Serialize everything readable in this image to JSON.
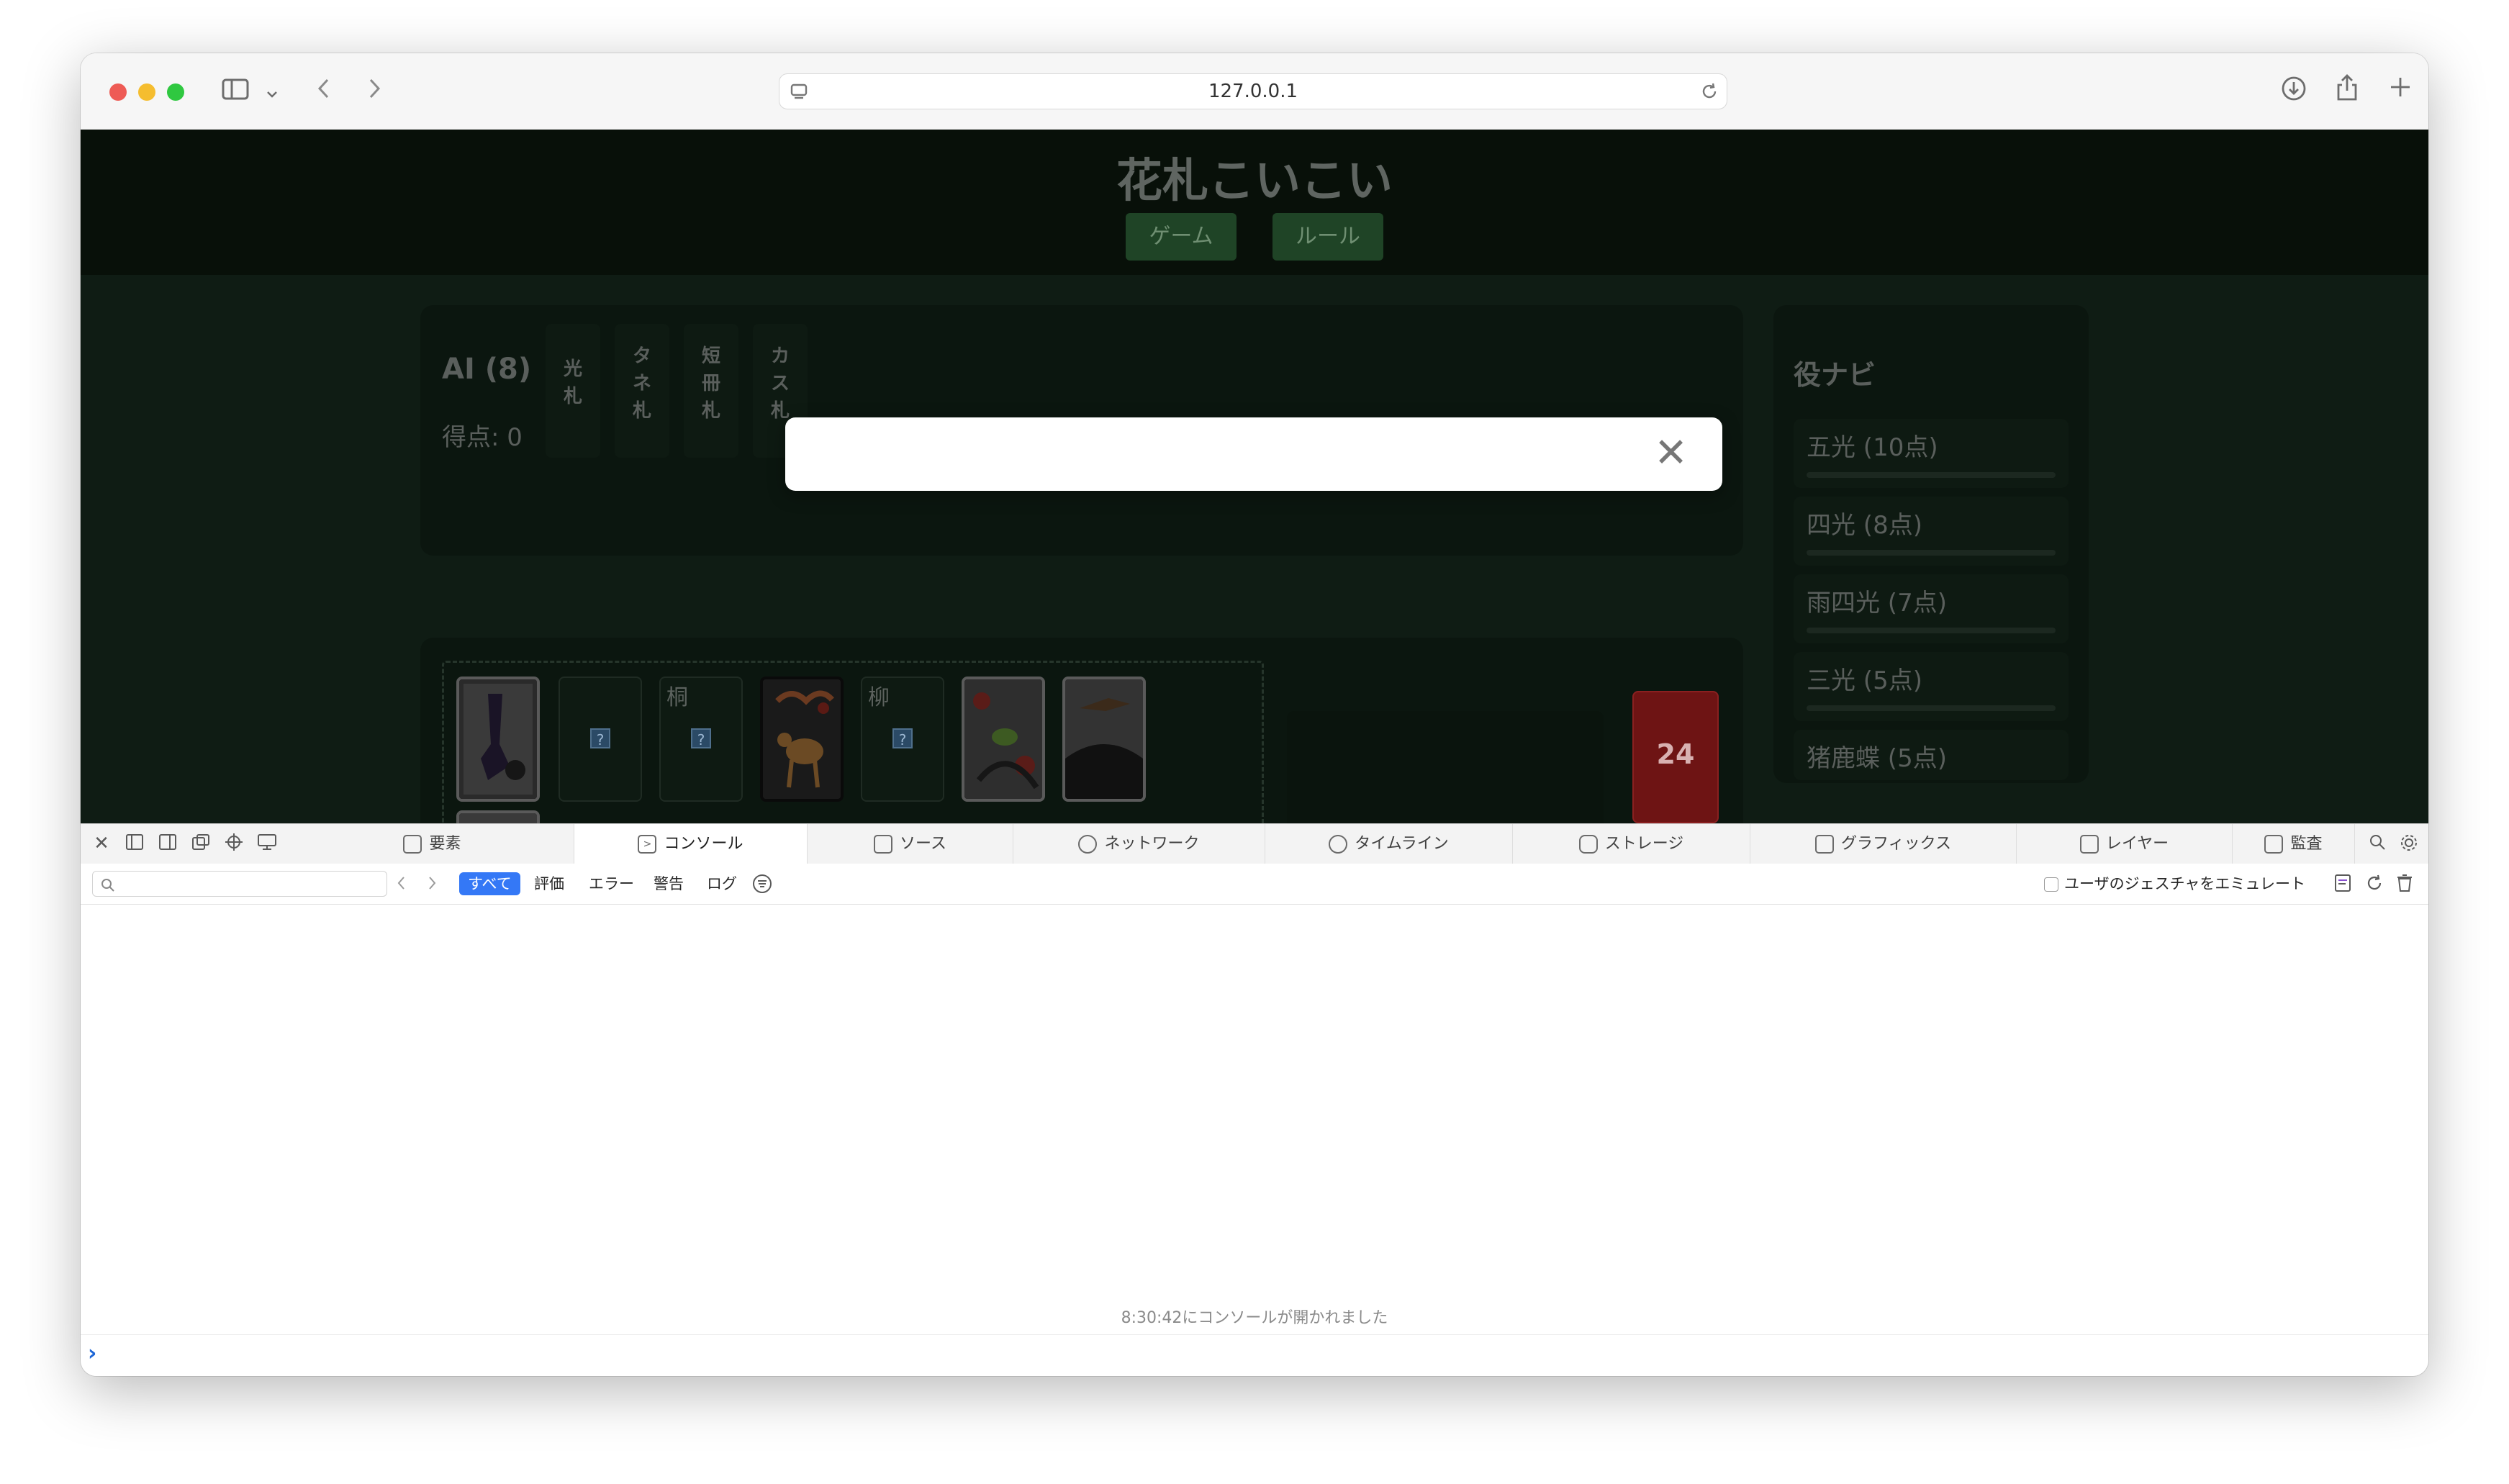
{
  "browser": {
    "url": "127.0.0.1"
  },
  "game": {
    "title": "花札こいこい",
    "nav": [
      "ゲーム",
      "ルール"
    ],
    "opponent": {
      "name": "AI (8)",
      "score": "得点: 0"
    },
    "categories": [
      "光札",
      "タネ札",
      "短冊札",
      "カス札"
    ],
    "field_card_labels": [
      "桐",
      "柳"
    ],
    "deck_count": "24",
    "yaku_navi": {
      "title": "役ナビ",
      "items": [
        "五光 (10点)",
        "四光 (8点)",
        "雨四光 (7点)",
        "三光 (5点)",
        "猪鹿蝶 (5点)"
      ]
    },
    "modal": {
      "close_symbol": "✕"
    }
  },
  "devtools": {
    "tabs": [
      "要素",
      "コンソール",
      "ソース",
      "ネットワーク",
      "タイムライン",
      "ストレージ",
      "グラフィックス",
      "レイヤー",
      "監査"
    ],
    "active_tab": "コンソール",
    "filters": [
      "すべて",
      "評価",
      "エラー",
      "警告",
      "ログ"
    ],
    "emulate_label": "ユーザのジェスチャをエミュレート",
    "console_message": "8:30:42にコンソールが開かれました",
    "prompt_symbol": "›"
  }
}
